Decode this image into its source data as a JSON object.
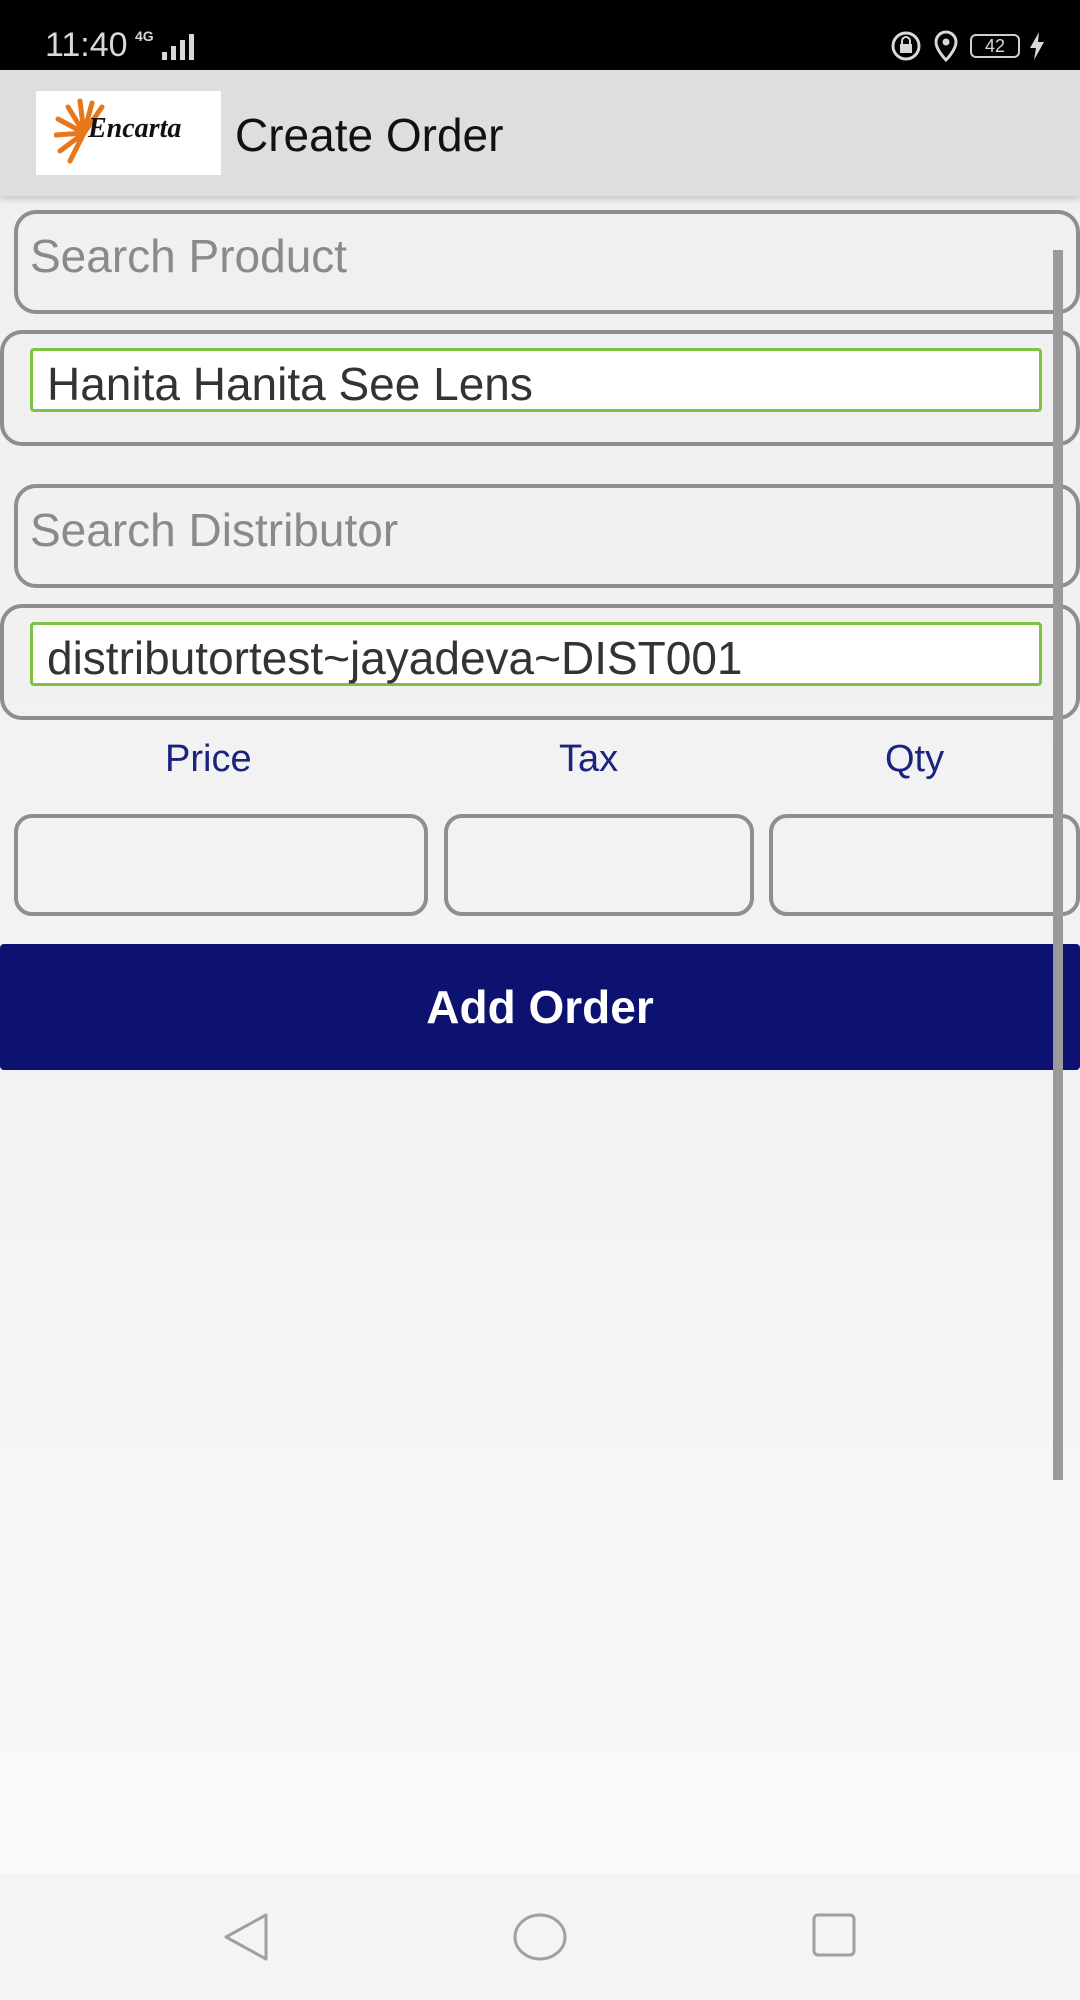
{
  "status_bar": {
    "time": "11:40",
    "network": "4G",
    "battery": "42"
  },
  "app_bar": {
    "logo_text": "Encarta",
    "title": "Create Order"
  },
  "form": {
    "search_product_placeholder": "Search Product",
    "selected_product": "Hanita Hanita See Lens",
    "search_distributor_placeholder": "Search Distributor",
    "selected_distributor": "distributortest~jayadeva~DIST001",
    "price_label": "Price",
    "tax_label": "Tax",
    "qty_label": "Qty",
    "price_value": "",
    "tax_value": "",
    "qty_value": ""
  },
  "actions": {
    "add_order_label": "Add Order"
  },
  "colors": {
    "accent": "#0d1170",
    "label": "#1a237e",
    "selected_border": "#7cc243"
  },
  "icons": [
    "lock-icon",
    "location-icon",
    "battery-icon",
    "charging-icon",
    "back-icon",
    "home-icon",
    "recents-icon"
  ]
}
